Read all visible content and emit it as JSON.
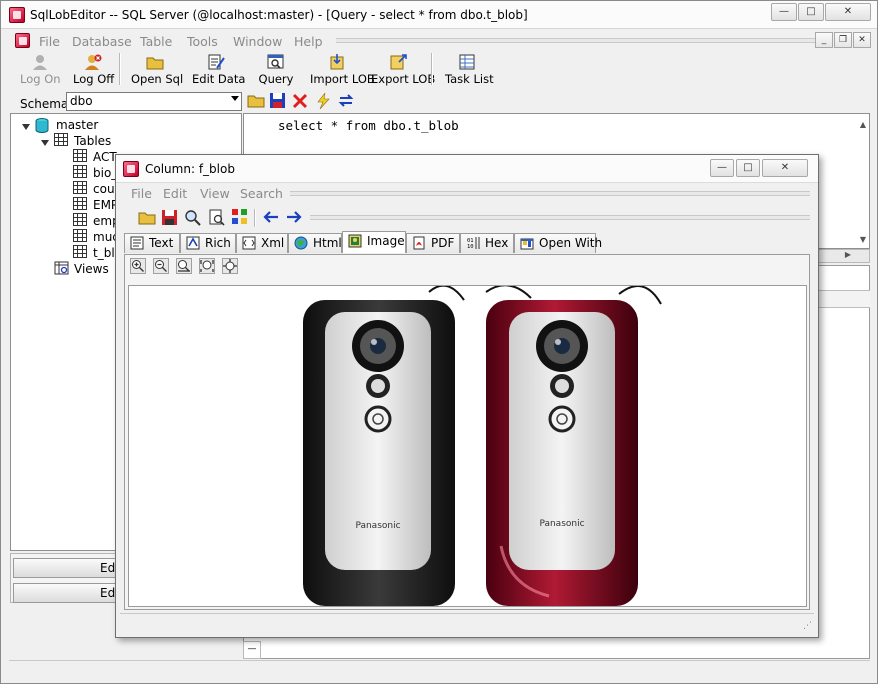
{
  "window": {
    "title": "SqlLobEditor -- SQL Server (@localhost:master) - [Query - select * from dbo.t_blob]",
    "minimize": "—",
    "maximize": "□",
    "close": "✕"
  },
  "menu": {
    "items": [
      "File",
      "Database",
      "Table",
      "Tools",
      "Window",
      "Help"
    ]
  },
  "toolbar": {
    "buttons": [
      {
        "label": "Log On",
        "icon": "user-icon",
        "enabled": false
      },
      {
        "label": "Log Off",
        "icon": "logoff-icon",
        "enabled": true
      },
      {
        "label": "Open Sql",
        "icon": "folder-icon",
        "enabled": true
      },
      {
        "label": "Edit Data",
        "icon": "edit-data-icon",
        "enabled": true
      },
      {
        "label": "Query",
        "icon": "query-icon",
        "enabled": true
      },
      {
        "label": "Import LOB",
        "icon": "import-icon",
        "enabled": true
      },
      {
        "label": "Export LOB",
        "icon": "export-icon",
        "enabled": true
      },
      {
        "label": "Task List",
        "icon": "task-list-icon",
        "enabled": true
      }
    ]
  },
  "schema": {
    "label": "Schema",
    "value": "dbo"
  },
  "tree": {
    "root": "master",
    "tables_label": "Tables",
    "tables": [
      "ACT",
      "bio_p",
      "cour",
      "EMP",
      "empl",
      "much",
      "t_blo"
    ],
    "views_label": "Views"
  },
  "left_buttons": [
    "Edi",
    "Edi"
  ],
  "query": {
    "sql": "select * from dbo.t_blob"
  },
  "dialog": {
    "title": "Column: f_blob",
    "menu": [
      "File",
      "Edit",
      "View",
      "Search"
    ],
    "tabs": [
      {
        "label": "Text",
        "icon": "text-icon"
      },
      {
        "label": "Rich",
        "icon": "rich-icon"
      },
      {
        "label": "Xml",
        "icon": "xml-icon"
      },
      {
        "label": "Html",
        "icon": "html-icon"
      },
      {
        "label": "Image",
        "icon": "image-icon",
        "active": true
      },
      {
        "label": "PDF",
        "icon": "pdf-icon"
      },
      {
        "label": "Hex",
        "icon": "hex-icon"
      },
      {
        "label": "Open With",
        "icon": "open-with-icon"
      }
    ],
    "phone_brand": "Panasonic"
  },
  "colors": {
    "phone_black": "#1c1c1c",
    "phone_red": "#7a0a1e",
    "accent_blue": "#1b3fbf"
  }
}
